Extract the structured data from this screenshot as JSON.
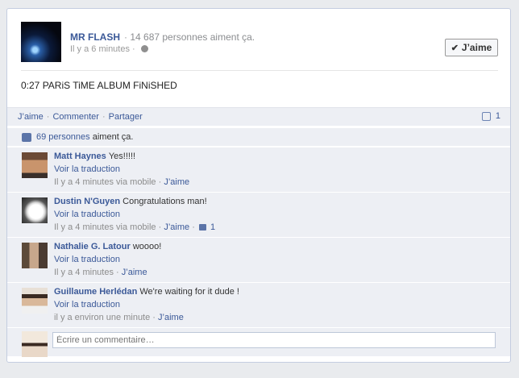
{
  "post": {
    "page_name": "MR FLASH",
    "likes_text": "14 687 personnes aiment ça.",
    "time": "Il y a 6 minutes",
    "like_button": "J’aime",
    "text": "0:27 PARiS TiME ALBUM FiNiSHED"
  },
  "actions": {
    "like": "J’aime",
    "comment": "Commenter",
    "share": "Partager",
    "comment_count": "1"
  },
  "likes": {
    "link": "69 personnes",
    "rest": " aiment ça."
  },
  "comments": [
    {
      "author": "Matt Haynes",
      "text": "Yes!!!!!",
      "translate": "Voir la traduction",
      "meta": "Il y a 4 minutes via mobile",
      "like": "J’aime",
      "likes": ""
    },
    {
      "author": "Dustin N'Guyen",
      "text": "Congratulations man!",
      "translate": "Voir la traduction",
      "meta": "Il y a 4 minutes via mobile",
      "like": "J’aime",
      "likes": "1"
    },
    {
      "author": "Nathalie G. Latour",
      "text": "woooo!",
      "translate": "Voir la traduction",
      "meta": "Il y a 4 minutes",
      "like": "J’aime",
      "likes": ""
    },
    {
      "author": "Guillaume Herlédan",
      "text": "We're waiting for it dude !",
      "translate": "Voir la traduction",
      "meta": "il y a environ une minute",
      "like": "J’aime",
      "likes": ""
    }
  ],
  "compose": {
    "placeholder": "Écrire un commentaire…"
  },
  "colors": {
    "link": "#3b5998",
    "panel": "#edeff4"
  }
}
